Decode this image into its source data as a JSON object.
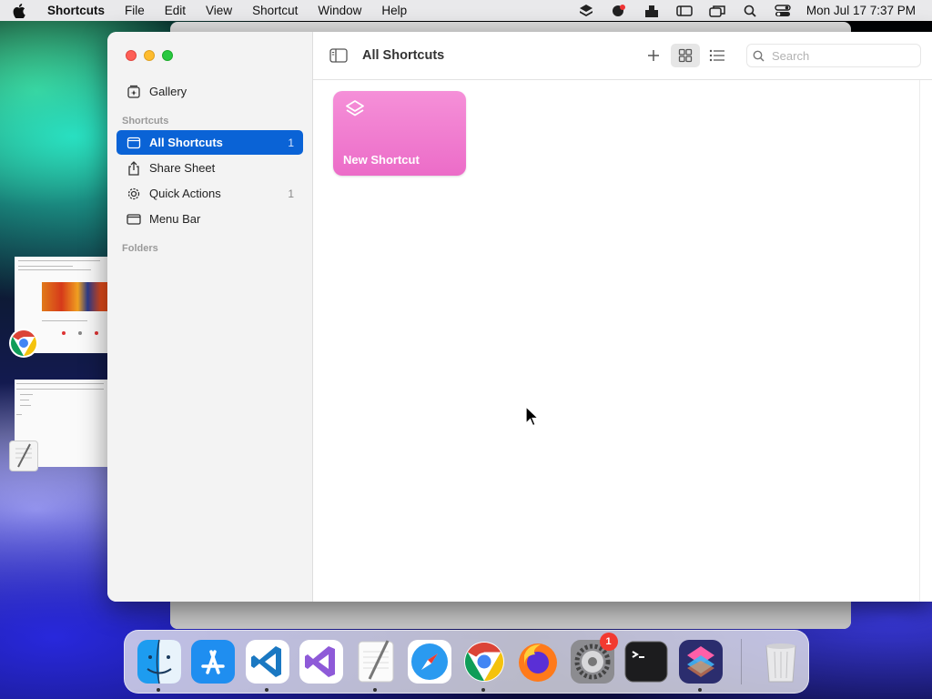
{
  "menubar": {
    "app_name": "Shortcuts",
    "items": [
      "File",
      "Edit",
      "View",
      "Shortcut",
      "Window",
      "Help"
    ],
    "clock": "Mon Jul 17  7:37 PM",
    "status_icons": [
      "stacks-icon",
      "creative-cloud-icon",
      "drive-icon",
      "display-icon",
      "screen-mirror-icon",
      "spotlight-search-icon",
      "control-center-icon"
    ]
  },
  "window": {
    "title": "All Shortcuts",
    "sidebar": {
      "gallery_label": "Gallery",
      "section_shortcuts": "Shortcuts",
      "section_folders": "Folders",
      "items": [
        {
          "label": "All Shortcuts",
          "count": "1",
          "icon": "tray-icon",
          "active": true
        },
        {
          "label": "Share Sheet",
          "count": "",
          "icon": "share-icon",
          "active": false
        },
        {
          "label": "Quick Actions",
          "count": "1",
          "icon": "gear-icon",
          "active": false
        },
        {
          "label": "Menu Bar",
          "count": "",
          "icon": "menubar-icon",
          "active": false
        }
      ]
    },
    "toolbar": {
      "search_placeholder": "Search"
    },
    "shortcuts": [
      {
        "label": "New Shortcut",
        "color": "#ef7ace",
        "icon": "layers-icon"
      }
    ]
  },
  "dock": {
    "items": [
      "Finder",
      "App Store",
      "Visual Studio Code",
      "Visual Studio",
      "TextEdit",
      "Safari",
      "Google Chrome",
      "Firefox",
      "System Settings",
      "Terminal",
      "Shortcuts",
      "Trash"
    ],
    "badge_system_settings": "1"
  },
  "colors": {
    "accent": "#0a63d6",
    "card_pink": "#ef7ace"
  }
}
